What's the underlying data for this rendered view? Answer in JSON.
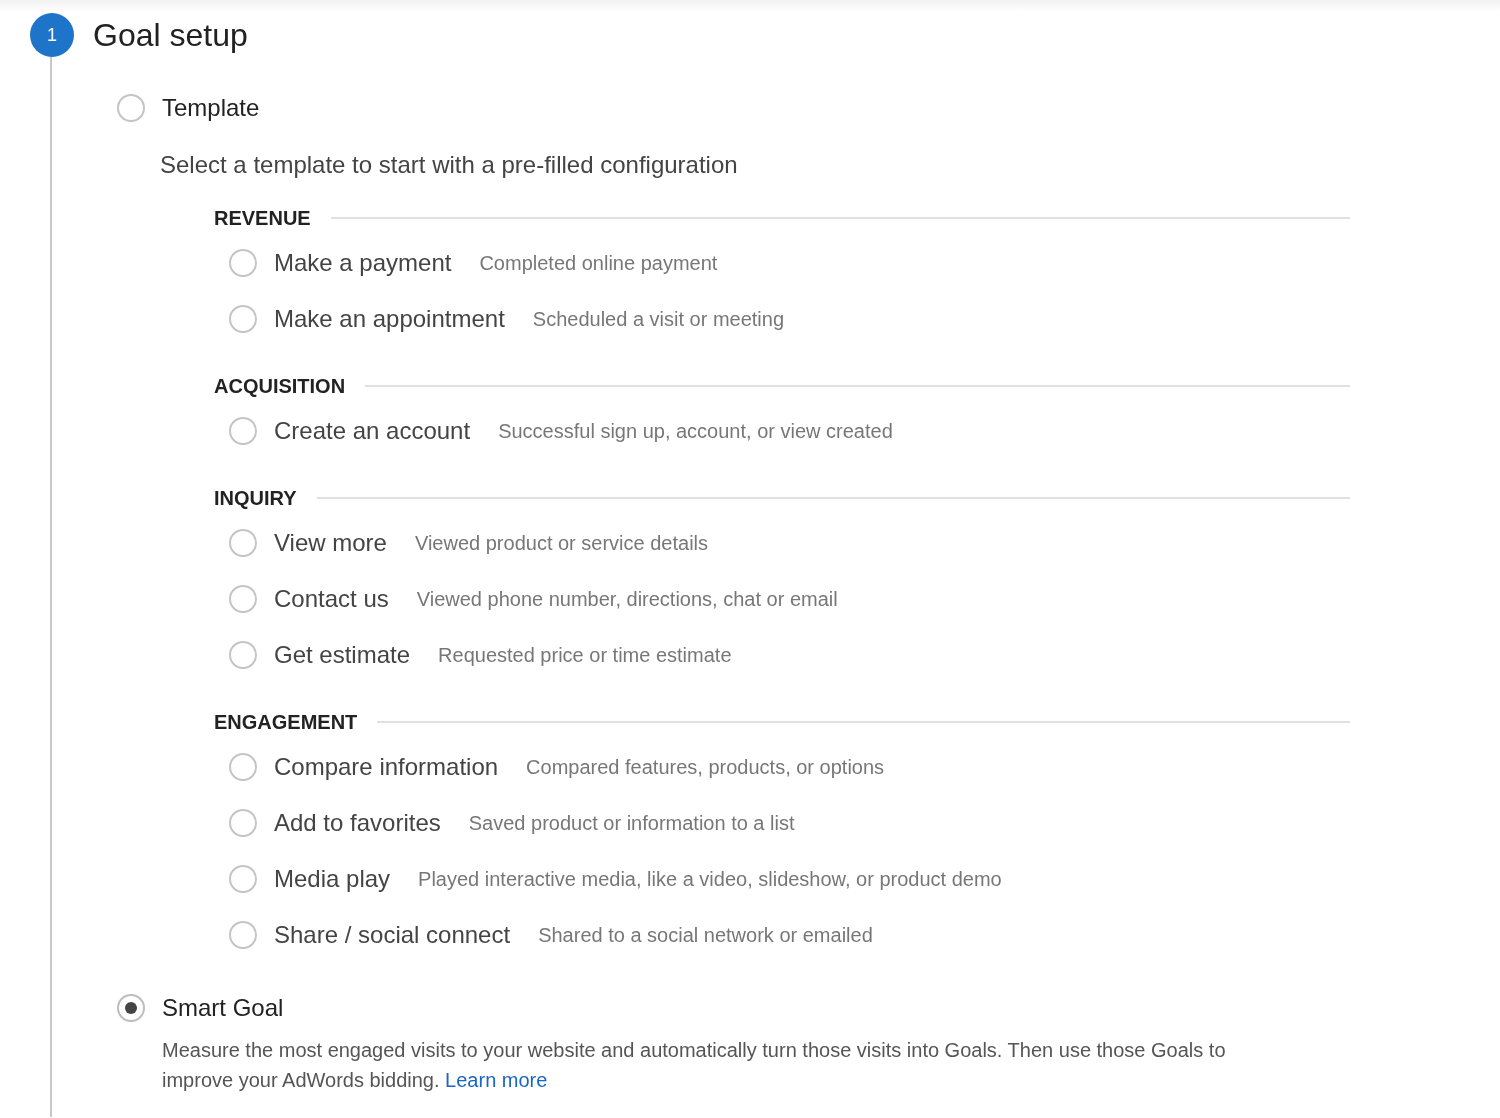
{
  "step": {
    "number": "1",
    "title": "Goal setup"
  },
  "modes": [
    {
      "kind": "template",
      "label": "Template",
      "selected": false,
      "description": "Select a template to start with a pre-filled configuration",
      "groups": [
        {
          "heading": "REVENUE",
          "options": [
            {
              "label": "Make a payment",
              "description": "Completed online payment",
              "selected": false
            },
            {
              "label": "Make an appointment",
              "description": "Scheduled a visit or meeting",
              "selected": false
            }
          ]
        },
        {
          "heading": "ACQUISITION",
          "options": [
            {
              "label": "Create an account",
              "description": "Successful sign up, account, or view created",
              "selected": false
            }
          ]
        },
        {
          "heading": "INQUIRY",
          "options": [
            {
              "label": "View more",
              "description": "Viewed product or service details",
              "selected": false
            },
            {
              "label": "Contact us",
              "description": "Viewed phone number, directions, chat or email",
              "selected": false
            },
            {
              "label": "Get estimate",
              "description": "Requested price or time estimate",
              "selected": false
            }
          ]
        },
        {
          "heading": "ENGAGEMENT",
          "options": [
            {
              "label": "Compare information",
              "description": "Compared features, products, or options",
              "selected": false
            },
            {
              "label": "Add to favorites",
              "description": "Saved product or information to a list",
              "selected": false
            },
            {
              "label": "Media play",
              "description": "Played interactive media, like a video, slideshow, or product demo",
              "selected": false
            },
            {
              "label": "Share / social connect",
              "description": "Shared to a social network or emailed",
              "selected": false
            }
          ]
        }
      ]
    },
    {
      "kind": "smart",
      "label": "Smart Goal",
      "selected": true,
      "description": "Measure the most engaged visits to your website and automatically turn those visits into Goals. Then use those Goals to improve your AdWords bidding.",
      "link": "Learn more"
    }
  ]
}
